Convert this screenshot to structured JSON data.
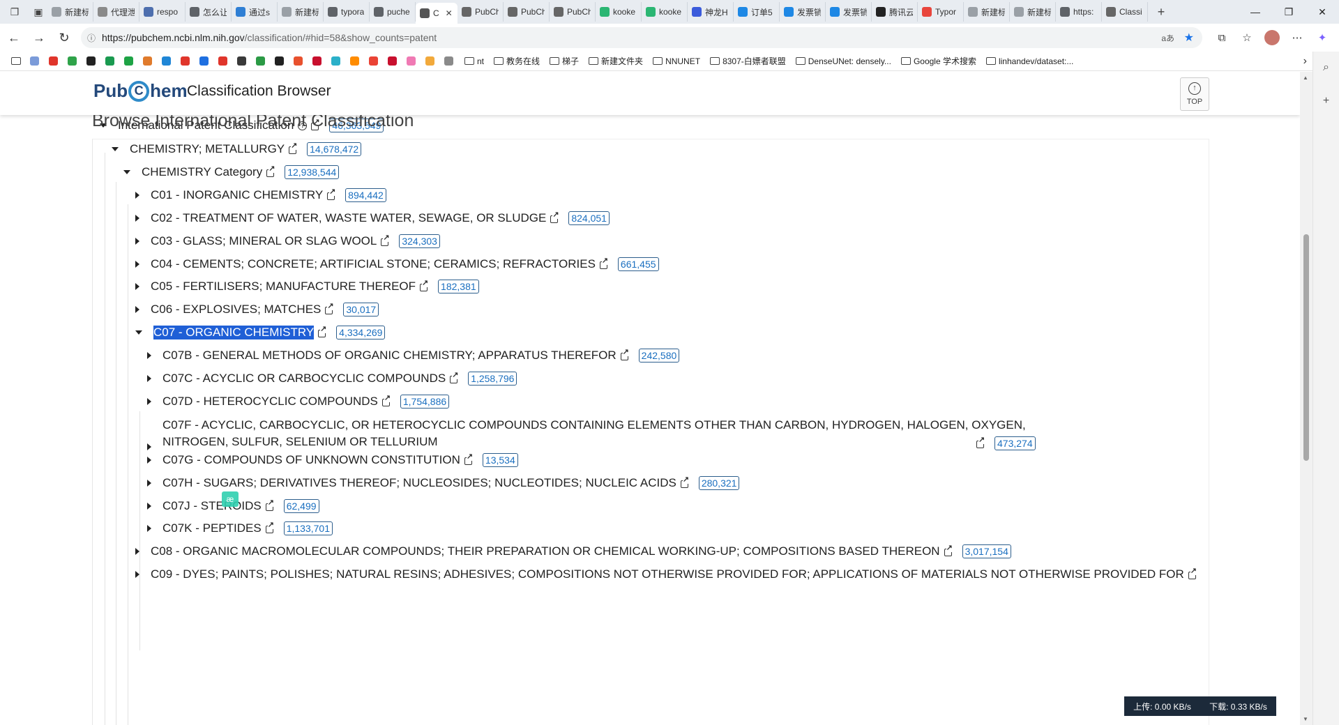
{
  "browser": {
    "tabs": [
      {
        "label": "新建标",
        "color": "#9aa0a6"
      },
      {
        "label": "代理泄",
        "color": "#8a8a8a"
      },
      {
        "label": "respo",
        "color": "#4e6fae"
      },
      {
        "label": "怎么让",
        "color": "#5f6368"
      },
      {
        "label": "通过s",
        "color": "#2f7fd4"
      },
      {
        "label": "新建标",
        "color": "#9aa0a6"
      },
      {
        "label": "typora",
        "color": "#5f6368"
      },
      {
        "label": "puche",
        "color": "#5f6368"
      },
      {
        "label": "C",
        "color": "#555555",
        "active": true
      },
      {
        "label": "PubCh",
        "color": "#666666"
      },
      {
        "label": "PubCh",
        "color": "#666666"
      },
      {
        "label": "PubCh",
        "color": "#666666"
      },
      {
        "label": "kooke",
        "color": "#2bb673"
      },
      {
        "label": "kooke",
        "color": "#2bb673"
      },
      {
        "label": "神龙H",
        "color": "#3b5bdb"
      },
      {
        "label": "订单5",
        "color": "#1e88e5"
      },
      {
        "label": "发票销",
        "color": "#1e88e5"
      },
      {
        "label": "发票销",
        "color": "#1e88e5"
      },
      {
        "label": "腾讯云",
        "color": "#222222"
      },
      {
        "label": "Typor",
        "color": "#e8453c"
      },
      {
        "label": "新建标",
        "color": "#9aa0a6"
      },
      {
        "label": "新建标",
        "color": "#9aa0a6"
      },
      {
        "label": "https:",
        "color": "#5f6368"
      },
      {
        "label": "Classi",
        "color": "#666666"
      }
    ],
    "url_domain": "https://pubchem.ncbi.nlm.nih.gov",
    "url_path": "/classification/#hid=58&show_counts=patent",
    "read_aloud": "aあ",
    "bookmark_icons": [
      "#7b9bd9",
      "#e0352b",
      "#2fa34a",
      "#222222",
      "#1a9a50",
      "#1ea345",
      "#e07b2c",
      "#1f86d6",
      "#e0352b",
      "#1f6fe0",
      "#e0352b",
      "#3a3a3a",
      "#2b9a45",
      "#222222",
      "#e8512e",
      "#c8102e",
      "#2bb0c9",
      "#ff8c00",
      "#ea4335",
      "#c8102e",
      "#f07ab4",
      "#f2a93b",
      "#8a8a8a"
    ],
    "bookmarks": [
      "nt",
      "教务在线",
      "梯子",
      "新建文件夹",
      "NNUNET",
      "8307-白嫖者联盟",
      "DenseUNet: densely...",
      "Google 学术搜索",
      "linhandev/dataset:..."
    ]
  },
  "page": {
    "logo_pub": "Pub",
    "logo_c": "C",
    "logo_hem": "hem",
    "app_title": "Classification Browser",
    "top_label": "TOP",
    "browse_title": "Browse International Patent Classification"
  },
  "tree": {
    "root": {
      "label": "International Patent Classification",
      "count": "46,363,549"
    },
    "section": {
      "label": "CHEMISTRY; METALLURGY",
      "count": "14,678,472"
    },
    "category": {
      "label": "CHEMISTRY Category",
      "count": "12,938,544"
    },
    "classes": [
      {
        "label": "C01 - INORGANIC CHEMISTRY",
        "count": "894,442"
      },
      {
        "label": "C02 - TREATMENT OF WATER, WASTE WATER, SEWAGE, OR SLUDGE",
        "count": "824,051"
      },
      {
        "label": "C03 - GLASS; MINERAL OR SLAG WOOL",
        "count": "324,303"
      },
      {
        "label": "C04 - CEMENTS; CONCRETE; ARTIFICIAL STONE; CERAMICS; REFRACTORIES",
        "count": "661,455"
      },
      {
        "label": "C05 - FERTILISERS; MANUFACTURE THEREOF",
        "count": "182,381"
      },
      {
        "label": "C06 - EXPLOSIVES; MATCHES",
        "count": "30,017"
      },
      {
        "label": "C07 - ORGANIC CHEMISTRY",
        "count": "4,334,269"
      }
    ],
    "subclasses": [
      {
        "label": "C07B - GENERAL METHODS OF ORGANIC CHEMISTRY; APPARATUS THEREFOR",
        "count": "242,580"
      },
      {
        "label": "C07C - ACYCLIC OR CARBOCYCLIC COMPOUNDS",
        "count": "1,258,796"
      },
      {
        "label": "C07D - HETEROCYCLIC COMPOUNDS",
        "count": "1,754,886"
      },
      {
        "label": "C07F - ACYCLIC, CARBOCYCLIC, OR HETEROCYCLIC COMPOUNDS CONTAINING ELEMENTS OTHER THAN CARBON, HYDROGEN, HALOGEN, OXYGEN, NITROGEN, SULFUR, SELENIUM OR TELLURIUM",
        "count": "473,274"
      },
      {
        "label": "C07G - COMPOUNDS OF UNKNOWN CONSTITUTION",
        "count": "13,534"
      },
      {
        "label": "C07H - SUGARS; DERIVATIVES THEREOF; NUCLEOSIDES; NUCLEOTIDES; NUCLEIC ACIDS",
        "count": "280,321"
      },
      {
        "label": "C07J - STEROIDS",
        "count": "62,499"
      },
      {
        "label": "C07K - PEPTIDES",
        "count": "1,133,701"
      }
    ],
    "later_classes": [
      {
        "label": "C08 - ORGANIC MACROMOLECULAR COMPOUNDS; THEIR PREPARATION OR CHEMICAL WORKING-UP; COMPOSITIONS BASED THEREON",
        "count": "3,017,154"
      },
      {
        "label": "C09 - DYES; PAINTS; POLISHES; NATURAL RESINS; ADHESIVES; COMPOSITIONS NOT OTHERWISE PROVIDED FOR; APPLICATIONS OF MATERIALS NOT OTHERWISE PROVIDED FOR",
        "count": ""
      }
    ]
  },
  "overlay": {
    "ocr_badge": "æ",
    "upload": "上传: 0.00 KB/s",
    "download": "下载: 0.33 KB/s"
  },
  "colors": {
    "accent": "#1f5fd6",
    "count_text": "#1a6fc0",
    "logo": "#24497b"
  }
}
